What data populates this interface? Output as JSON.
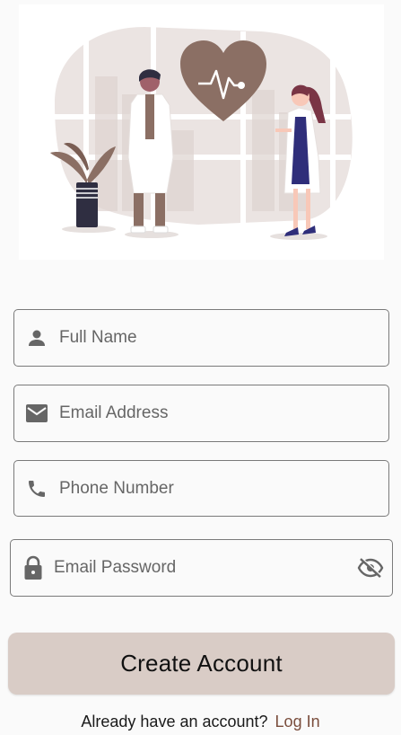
{
  "illustration": {
    "name": "doctors-illustration",
    "accent": "#8b6f64",
    "blob": "#ebe4e2"
  },
  "form": {
    "full_name": {
      "placeholder": "Full Name",
      "icon": "person-icon"
    },
    "email": {
      "placeholder": "Email Address",
      "icon": "mail-icon"
    },
    "phone": {
      "placeholder": "Phone Number",
      "icon": "phone-icon"
    },
    "password": {
      "placeholder": "Email Password",
      "icon": "lock-icon",
      "toggle_icon": "eye-off-icon"
    }
  },
  "cta": {
    "label": "Create Account",
    "color": "#d9ccc6"
  },
  "footer": {
    "text": "Already have an account?",
    "link": "Log In",
    "link_color": "#7a4d3c"
  }
}
